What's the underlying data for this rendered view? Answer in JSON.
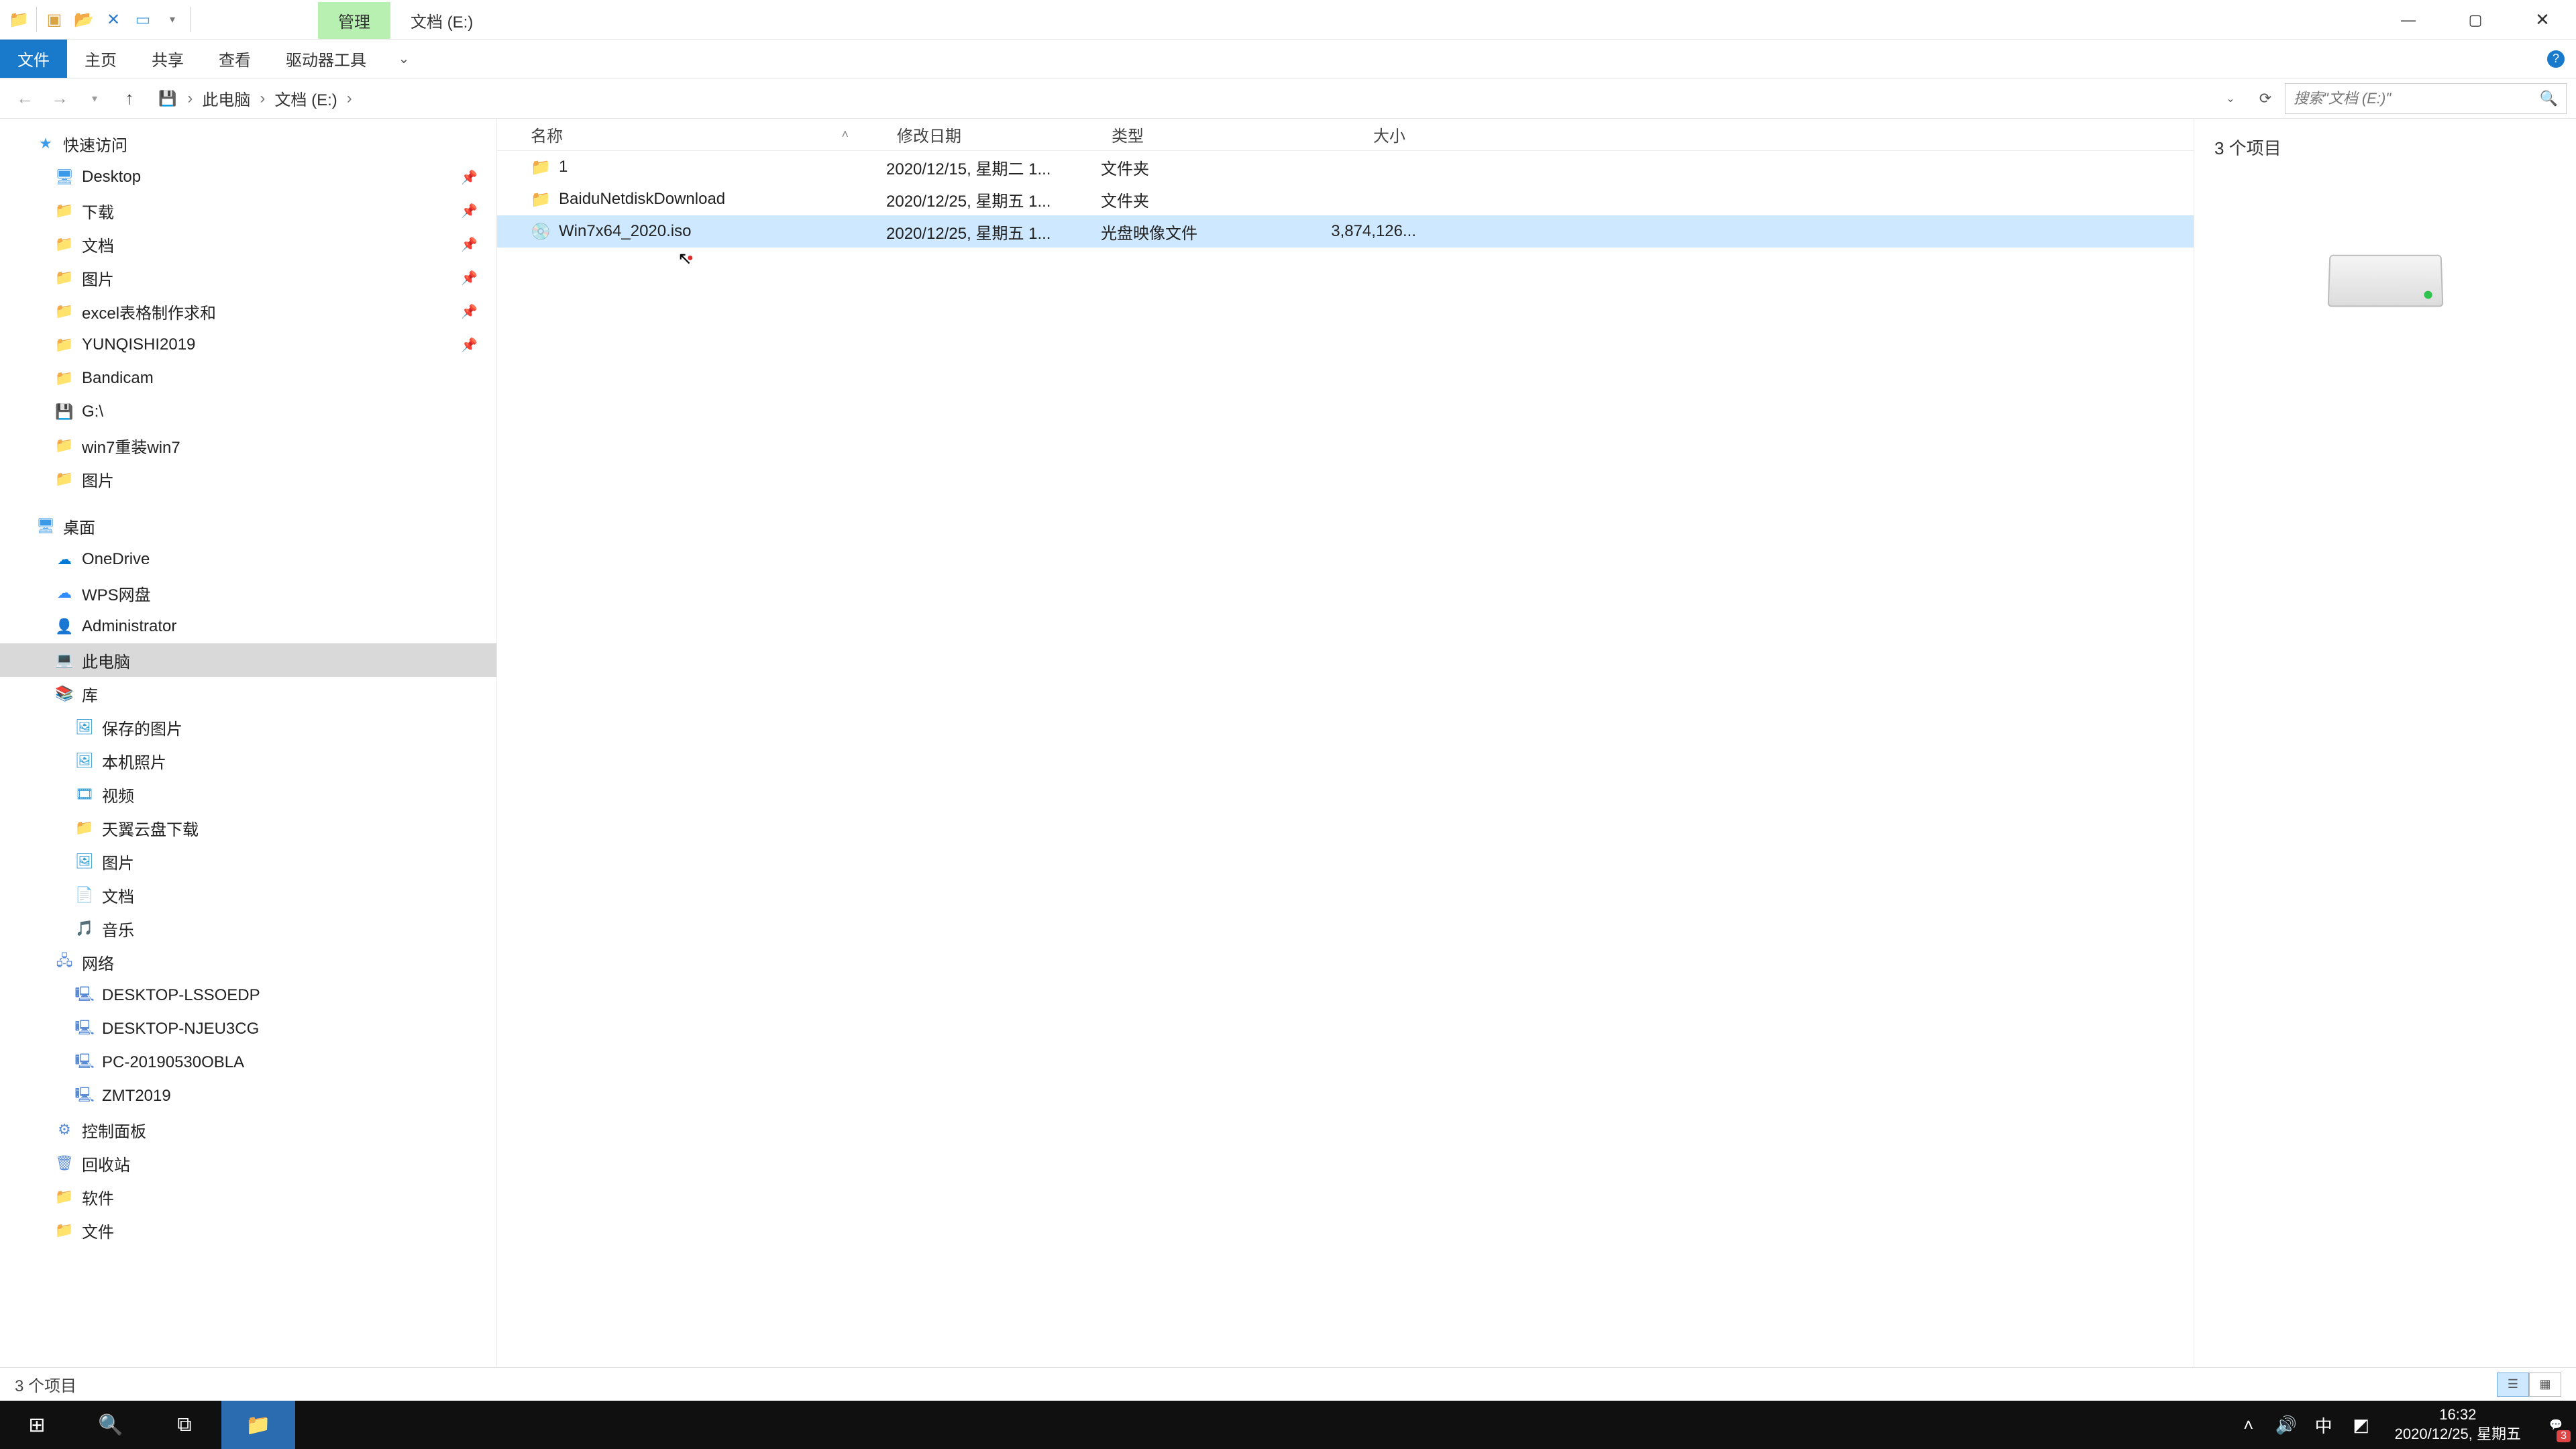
{
  "title_tabs": {
    "manage": "管理",
    "location": "文档 (E:)"
  },
  "ribbon": {
    "file": "文件",
    "home": "主页",
    "share": "共享",
    "view": "查看",
    "drive_tools": "驱动器工具"
  },
  "breadcrumb": {
    "pc": "此电脑",
    "drive": "文档 (E:)"
  },
  "search": {
    "placeholder": "搜索\"文档 (E:)\""
  },
  "columns": {
    "name": "名称",
    "date": "修改日期",
    "type": "类型",
    "size": "大小"
  },
  "rows": [
    {
      "name": "1",
      "date": "2020/12/15, 星期二 1...",
      "type": "文件夹",
      "size": "",
      "icon": "folder",
      "selected": false
    },
    {
      "name": "BaiduNetdiskDownload",
      "date": "2020/12/25, 星期五 1...",
      "type": "文件夹",
      "size": "",
      "icon": "folder",
      "selected": false
    },
    {
      "name": "Win7x64_2020.iso",
      "date": "2020/12/25, 星期五 1...",
      "type": "光盘映像文件",
      "size": "3,874,126...",
      "icon": "iso",
      "selected": true
    }
  ],
  "preview": {
    "count": "3 个项目"
  },
  "status": {
    "count": "3 个项目"
  },
  "tree": {
    "quick_access": "快速访问",
    "qa_items": [
      {
        "label": "Desktop",
        "icon": "desktop",
        "pin": true
      },
      {
        "label": "下载",
        "icon": "folder",
        "pin": true
      },
      {
        "label": "文档",
        "icon": "folder",
        "pin": true
      },
      {
        "label": "图片",
        "icon": "folder",
        "pin": true
      },
      {
        "label": "excel表格制作求和",
        "icon": "folder",
        "pin": true
      },
      {
        "label": "YUNQISHI2019",
        "icon": "folder",
        "pin": true
      },
      {
        "label": "Bandicam",
        "icon": "folder",
        "pin": false
      },
      {
        "label": "G:\\",
        "icon": "drive",
        "pin": false
      },
      {
        "label": "win7重装win7",
        "icon": "folder",
        "pin": false
      },
      {
        "label": "图片",
        "icon": "folder",
        "pin": false
      }
    ],
    "desktop": "桌面",
    "desktop_items": [
      {
        "label": "OneDrive",
        "icon": "onedrive"
      },
      {
        "label": "WPS网盘",
        "icon": "wps"
      },
      {
        "label": "Administrator",
        "icon": "user"
      },
      {
        "label": "此电脑",
        "icon": "pc",
        "selected": true
      },
      {
        "label": "库",
        "icon": "lib"
      }
    ],
    "lib_items": [
      {
        "label": "保存的图片",
        "icon": "pic"
      },
      {
        "label": "本机照片",
        "icon": "pic"
      },
      {
        "label": "视频",
        "icon": "vid"
      },
      {
        "label": "天翼云盘下载",
        "icon": "folder"
      },
      {
        "label": "图片",
        "icon": "pic"
      },
      {
        "label": "文档",
        "icon": "doc"
      },
      {
        "label": "音乐",
        "icon": "music"
      }
    ],
    "network": "网络",
    "net_items": [
      {
        "label": "DESKTOP-LSSOEDP",
        "icon": "comp"
      },
      {
        "label": "DESKTOP-NJEU3CG",
        "icon": "comp"
      },
      {
        "label": "PC-20190530OBLA",
        "icon": "comp"
      },
      {
        "label": "ZMT2019",
        "icon": "comp"
      }
    ],
    "control_panel": "控制面板",
    "recycle": "回收站",
    "software": "软件",
    "docs": "文件"
  },
  "taskbar": {
    "time": "16:32",
    "date": "2020/12/25, 星期五",
    "ime": "中",
    "notif_badge": "3"
  }
}
